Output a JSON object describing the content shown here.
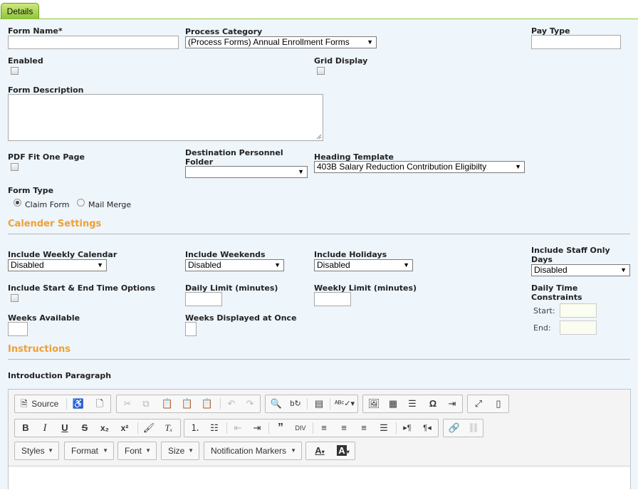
{
  "tabs": {
    "details": "Details"
  },
  "form": {
    "form_name_label": "Form Name*",
    "process_category_label": "Process Category",
    "process_category_value": "(Process Forms) Annual Enrollment Forms",
    "pay_type_label": "Pay Type",
    "enabled_label": "Enabled",
    "grid_display_label": "Grid Display",
    "form_description_label": "Form Description",
    "pdf_fit_label": "PDF Fit One Page",
    "dest_folder_label_1": "Destination Personnel",
    "dest_folder_label_2": "Folder",
    "dest_folder_value": "",
    "heading_template_label": "Heading Template",
    "heading_template_value": "403B Salary Reduction Contribution Eligibilty",
    "form_type_label": "Form Type",
    "form_type_options": [
      "Claim Form",
      "Mail Merge"
    ],
    "form_type_selected": "Claim Form"
  },
  "calendar": {
    "section_title": "Calender Settings",
    "weekly_calendar_label": "Include Weekly Calendar",
    "weekly_calendar_value": "Disabled",
    "weekends_label": "Include Weekends",
    "weekends_value": "Disabled",
    "holidays_label": "Include Holidays",
    "holidays_value": "Disabled",
    "staff_only_label_1": "Include Staff Only",
    "staff_only_label_2": "Days",
    "staff_only_value": "Disabled",
    "start_end_label": "Include Start & End Time Options",
    "daily_limit_label": "Daily Limit (minutes)",
    "weekly_limit_label": "Weekly Limit (minutes)",
    "daily_time_label_1": "Daily Time",
    "daily_time_label_2": "Constraints",
    "start_label": "Start:",
    "end_label": "End:",
    "weeks_available_label": "Weeks Available",
    "weeks_displayed_label": "Weeks Displayed at Once"
  },
  "instructions": {
    "section_title": "Instructions",
    "intro_label": "Introduction Paragraph"
  },
  "editor": {
    "source_label": "Source",
    "combos": [
      "Styles",
      "Format",
      "Font",
      "Size",
      "Notification Markers"
    ]
  }
}
